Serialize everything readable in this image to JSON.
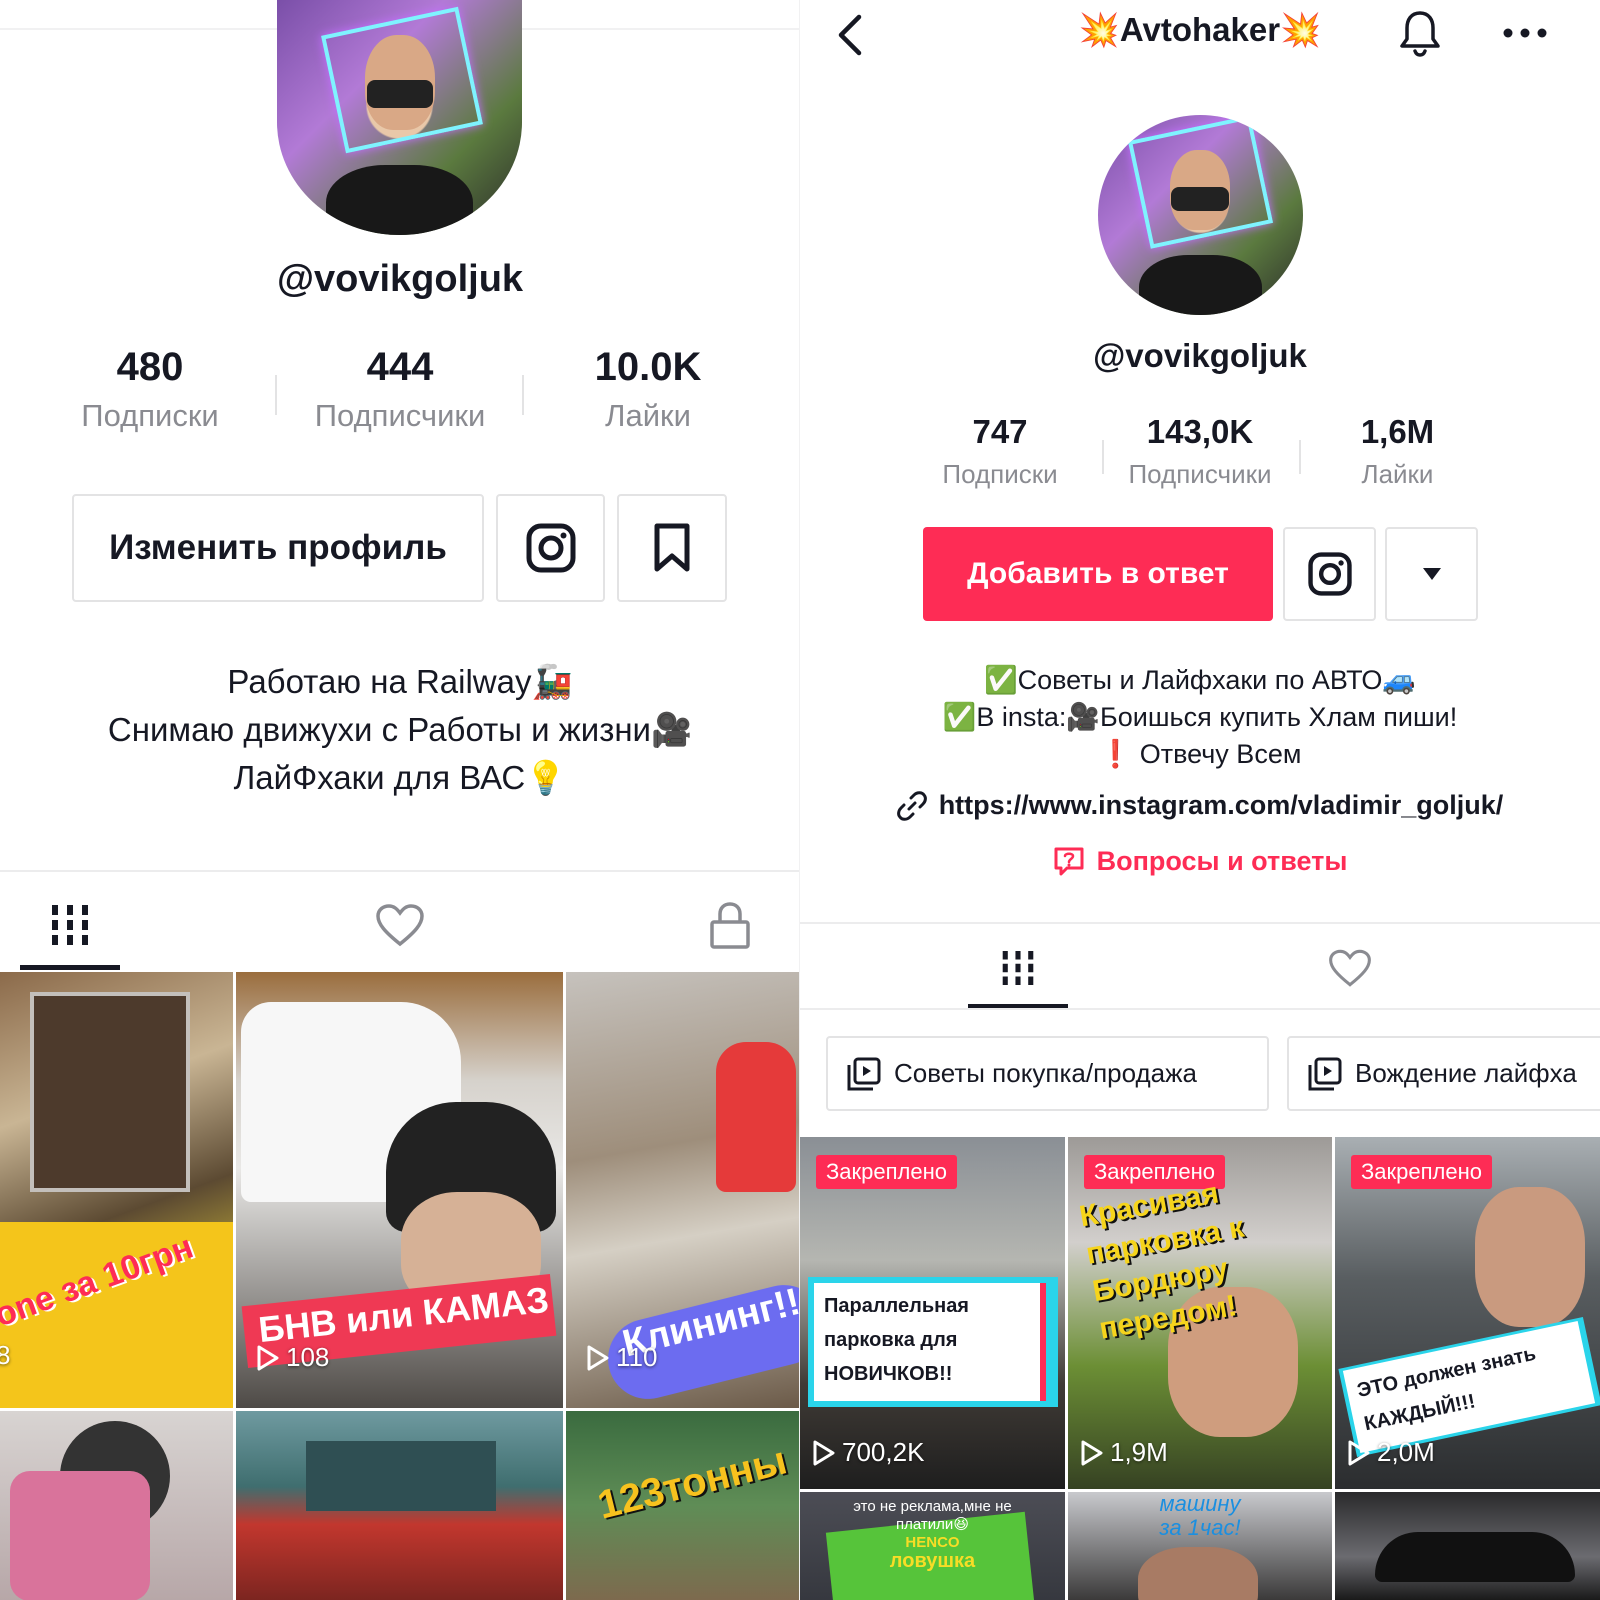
{
  "left": {
    "handle": "@vovikgoljuk",
    "stats": [
      {
        "value": "480",
        "label": "Подписки"
      },
      {
        "value": "444",
        "label": "Подписчики"
      },
      {
        "value": "10.0K",
        "label": "Лайки"
      }
    ],
    "edit_profile_label": "Изменить профиль",
    "bio": [
      "Работаю на Railway🚂",
      "Снимаю движухи с Работы и жизни🎥",
      "ЛайФхаки для ВАС💡"
    ],
    "videos": [
      {
        "caption": "one за 10грн",
        "views": "8"
      },
      {
        "caption": "БНВ или КАМАЗ",
        "views": "108"
      },
      {
        "caption": "Клининг!!",
        "views": "110"
      },
      {
        "caption": "",
        "views": ""
      },
      {
        "caption": "",
        "views": ""
      },
      {
        "caption": "123тонны",
        "views": ""
      }
    ]
  },
  "right": {
    "title": "💥Avtohaker💥",
    "handle": "@vovikgoljuk",
    "stats": [
      {
        "value": "747",
        "label": "Подписки"
      },
      {
        "value": "143,0K",
        "label": "Подписчики"
      },
      {
        "value": "1,6M",
        "label": "Лайки"
      }
    ],
    "reply_button_label": "Добавить в ответ",
    "bio": [
      "✅Советы и Лайфхаки по АВТО🚙",
      "✅В insta:🎥Боишься купить Хлам пиши!",
      "❗ Отвечу Всем"
    ],
    "link": "https://www.instagram.com/vladimir_goljuk/",
    "qa_label": "Вопросы и ответы",
    "playlists": [
      "Советы покупка/продажа",
      "Вождение лайфха"
    ],
    "pinned_label": "Закреплено",
    "videos": [
      {
        "caption_lines": [
          "Параллельная",
          "парковка для",
          "НОВИЧКОВ!!"
        ],
        "views": "700,2K"
      },
      {
        "caption_lines": [
          "Красивая",
          "парковка к",
          "Бордюру",
          "передом!"
        ],
        "views": "1,9M"
      },
      {
        "caption_lines": [
          "ЭТО должен знать",
          "КАЖДЫЙ!!!"
        ],
        "views": "2,0M"
      },
      {
        "caption_lines": [
          "это не реклама,мне не",
          "платили😆",
          "HENCO",
          "ловушка"
        ],
        "views": ""
      },
      {
        "caption_lines": [
          "машину",
          "за 1час!"
        ],
        "views": ""
      },
      {
        "caption_lines": [],
        "views": ""
      }
    ]
  },
  "colors": {
    "accent": "#fe2c55",
    "text": "#161823",
    "muted": "#8a8b91",
    "border": "#e3e3e4"
  },
  "icons": [
    "back-icon",
    "bell-icon",
    "more-icon",
    "instagram-icon",
    "bookmark-icon",
    "dropdown-icon",
    "grid-icon",
    "heart-icon",
    "lock-icon",
    "link-icon",
    "qa-icon",
    "playlist-icon",
    "play-icon"
  ]
}
